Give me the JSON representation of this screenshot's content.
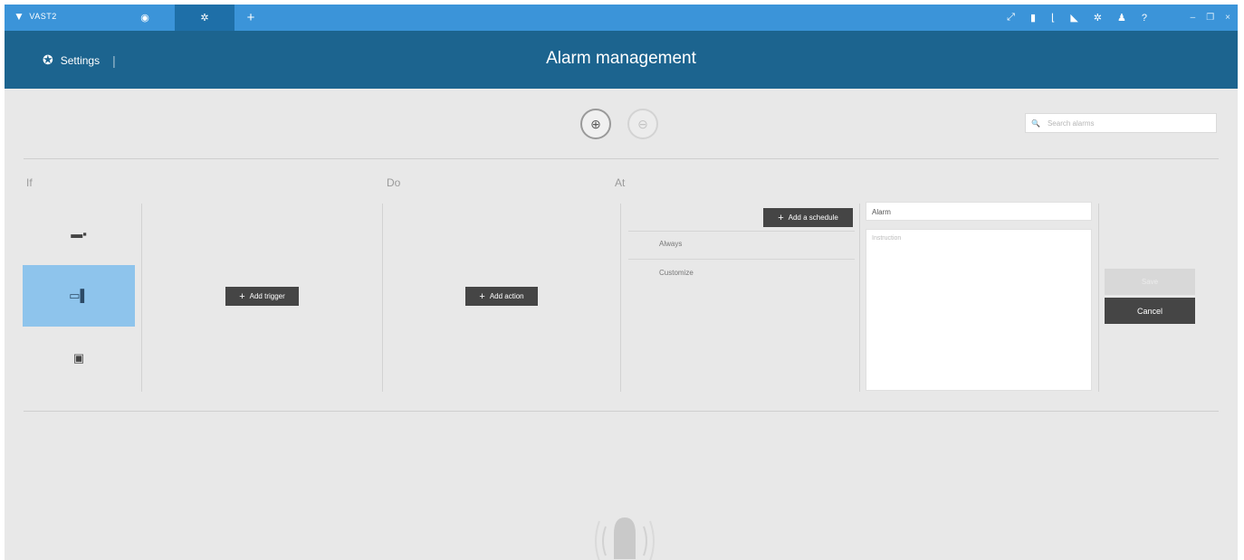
{
  "titlebar": {
    "brand": "VAST2",
    "tabs": [
      {
        "name": "live-view",
        "icon": "eye-icon"
      },
      {
        "name": "settings",
        "icon": "gear-icon",
        "active": true
      },
      {
        "name": "add",
        "icon": "plus-icon"
      }
    ],
    "right_icons": [
      "link-icon",
      "book-icon",
      "chart-icon",
      "export-icon",
      "gear-icon",
      "user-icon",
      "help-icon"
    ],
    "help_label": "?",
    "window_controls": [
      "minimize",
      "restore",
      "close"
    ]
  },
  "header": {
    "back_label": "Settings",
    "title": "Alarm management"
  },
  "toolbar": {
    "search_placeholder": "Search alarms"
  },
  "sections": {
    "if_label": "If",
    "do_label": "Do",
    "at_label": "At"
  },
  "trigger_sources": [
    {
      "icon": "camera-icon",
      "selected": false
    },
    {
      "icon": "monitor-icon",
      "selected": true
    },
    {
      "icon": "nvr-icon",
      "selected": false
    }
  ],
  "buttons": {
    "add_trigger": "Add trigger",
    "add_action": "Add action",
    "add_schedule": "Add a schedule",
    "save": "Save",
    "cancel": "Cancel"
  },
  "schedules": [
    "Always",
    "Customize"
  ],
  "alarm": {
    "name_value": "Alarm",
    "instruction_placeholder": "Instruction"
  },
  "colors": {
    "titlebar": "#3b94d9",
    "header": "#1c648f",
    "selected": "#8ec4ec",
    "dark_button": "#454545"
  }
}
